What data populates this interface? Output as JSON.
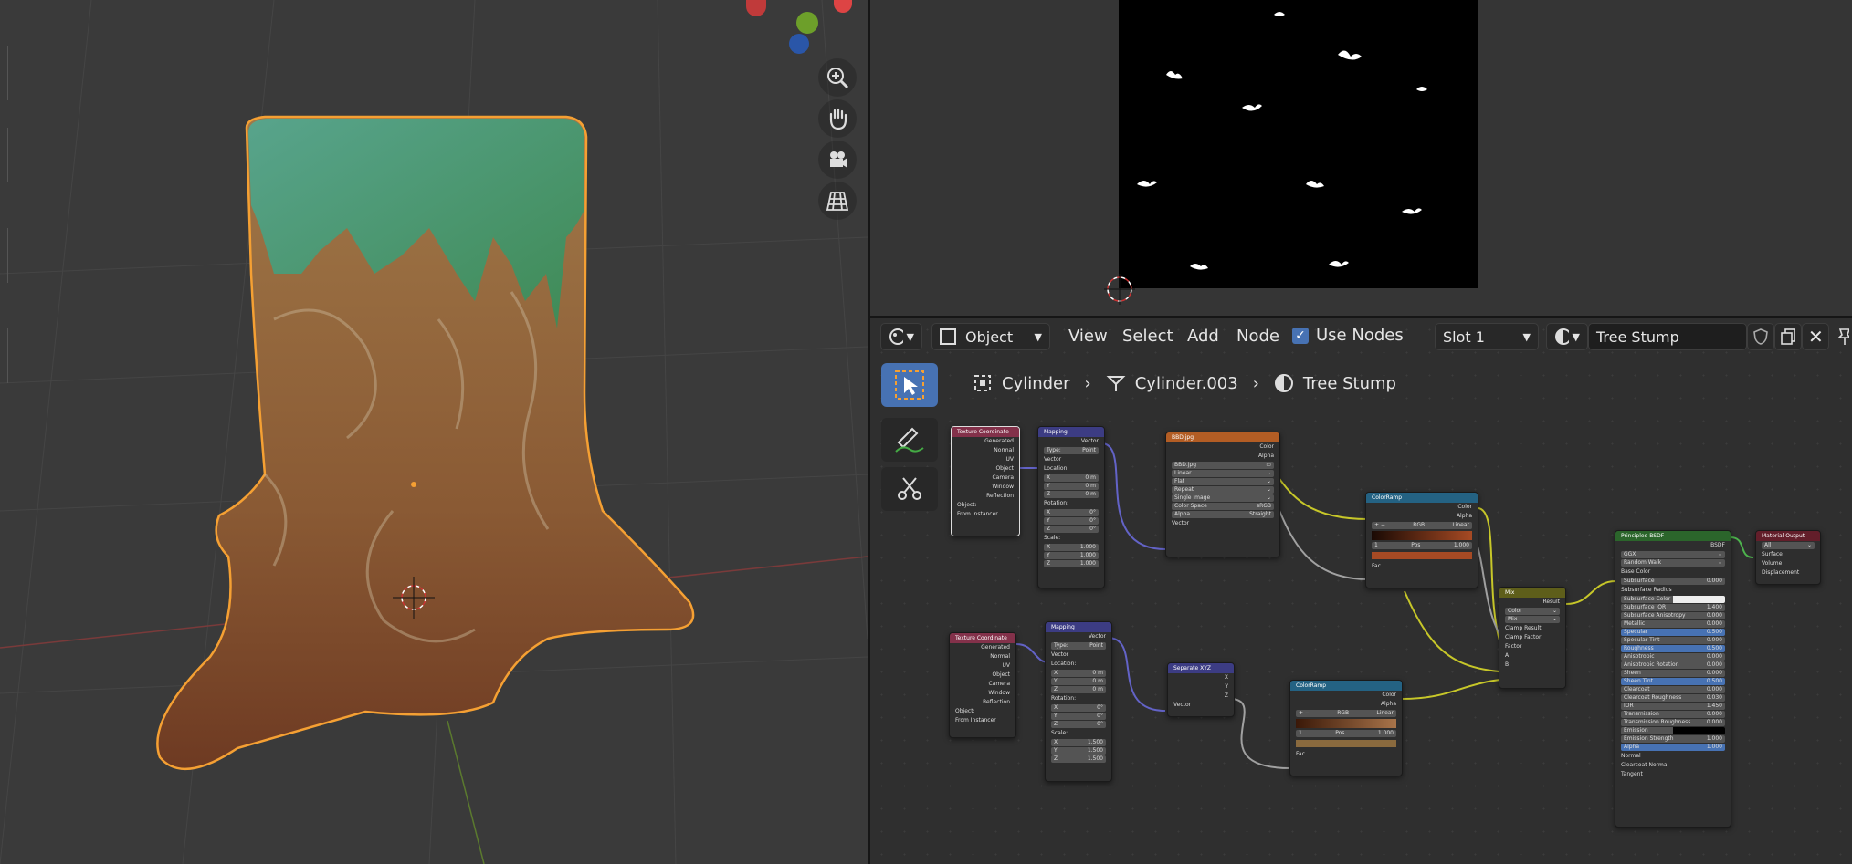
{
  "node_editor": {
    "header": {
      "editor_type_icon": "node-editor-icon",
      "mode_label": "Object",
      "menu_view": "View",
      "menu_select": "Select",
      "menu_add": "Add",
      "menu_node": "Node",
      "use_nodes_label": "Use Nodes",
      "slot_label": "Slot 1",
      "material_name": "Tree Stump"
    },
    "breadcrumb": {
      "object": "Cylinder",
      "mesh": "Cylinder.003",
      "material": "Tree Stump"
    },
    "nodes": {
      "texcoord1": {
        "title": "Texture Coordinate",
        "outputs": [
          "Generated",
          "Normal",
          "UV",
          "Object",
          "Camera",
          "Window",
          "Reflection"
        ],
        "object_label": "Object:",
        "from_instancer": "From Instancer"
      },
      "mapping1": {
        "title": "Mapping",
        "out": "Vector",
        "type_label": "Type:",
        "type_value": "Point",
        "in_vector": "Vector",
        "location": "Location:",
        "rotation": "Rotation:",
        "scale": "Scale:",
        "loc": [
          "0 m",
          "0 m",
          "0 m"
        ],
        "rot": [
          "0°",
          "0°",
          "0°"
        ],
        "scl": [
          "1.000",
          "1.000",
          "1.000"
        ]
      },
      "image": {
        "title": "BBD.jpg",
        "out_color": "Color",
        "out_alpha": "Alpha",
        "file": "BBD.jpg",
        "interp": "Linear",
        "proj": "Flat",
        "ext": "Repeat",
        "source": "Single Image",
        "cs_label": "Color Space",
        "cs_value": "sRGB",
        "alpha_label": "Alpha",
        "alpha_value": "Straight",
        "in_vector": "Vector"
      },
      "ramp1": {
        "title": "ColorRamp",
        "out_color": "Color",
        "out_alpha": "Alpha",
        "mode": "RGB",
        "interp": "Linear",
        "index": "1",
        "pos_label": "Pos",
        "pos_value": "1.000",
        "in_fac": "Fac"
      },
      "mix": {
        "title": "Mix",
        "out_result": "Result",
        "type": "Color",
        "blend": "Mix",
        "clamp_result": "Clamp Result",
        "clamp_factor": "Clamp Factor",
        "in_factor": "Factor",
        "in_a": "A",
        "in_b": "B"
      },
      "texcoord2": {
        "title": "Texture Coordinate",
        "outputs": [
          "Generated",
          "Normal",
          "UV",
          "Object",
          "Camera",
          "Window",
          "Reflection"
        ],
        "object_label": "Object:",
        "from_instancer": "From Instancer"
      },
      "mapping2": {
        "title": "Mapping",
        "out": "Vector",
        "type_label": "Type:",
        "type_value": "Point",
        "in_vector": "Vector",
        "location": "Location:",
        "rotation": "Rotation:",
        "scale": "Scale:",
        "loc": [
          "0 m",
          "0 m",
          "0 m"
        ],
        "rot": [
          "0°",
          "0°",
          "0°"
        ],
        "scl": [
          "1.500",
          "1.500",
          "1.500"
        ]
      },
      "separate": {
        "title": "Separate XYZ",
        "outs": [
          "X",
          "Y",
          "Z"
        ],
        "in_vector": "Vector"
      },
      "ramp2": {
        "title": "ColorRamp",
        "out_color": "Color",
        "out_alpha": "Alpha",
        "mode": "RGB",
        "interp": "Linear",
        "index": "1",
        "pos_label": "Pos",
        "pos_value": "1.000",
        "in_fac": "Fac"
      },
      "bsdf": {
        "title": "Principled BSDF",
        "out": "BSDF",
        "dist": "GGX",
        "sss": "Random Walk",
        "params": [
          [
            "Base Color",
            ""
          ],
          [
            "Subsurface",
            "0.000"
          ],
          [
            "Subsurface Radius",
            ""
          ],
          [
            "Subsurface Color",
            ""
          ],
          [
            "Subsurface IOR",
            "1.400"
          ],
          [
            "Subsurface Anisotropy",
            "0.000"
          ],
          [
            "Metallic",
            "0.000"
          ],
          [
            "Specular",
            "0.500"
          ],
          [
            "Specular Tint",
            "0.000"
          ],
          [
            "Roughness",
            "0.500"
          ],
          [
            "Anisotropic",
            "0.000"
          ],
          [
            "Anisotropic Rotation",
            "0.000"
          ],
          [
            "Sheen",
            "0.000"
          ],
          [
            "Sheen Tint",
            "0.500"
          ],
          [
            "Clearcoat",
            "0.000"
          ],
          [
            "Clearcoat Roughness",
            "0.030"
          ],
          [
            "IOR",
            "1.450"
          ],
          [
            "Transmission",
            "0.000"
          ],
          [
            "Transmission Roughness",
            "0.000"
          ],
          [
            "Emission",
            ""
          ],
          [
            "Emission Strength",
            "1.000"
          ],
          [
            "Alpha",
            "1.000"
          ],
          [
            "Normal",
            ""
          ],
          [
            "Clearcoat Normal",
            ""
          ],
          [
            "Tangent",
            ""
          ]
        ]
      },
      "output": {
        "title": "Material Output",
        "target": "All",
        "ins": [
          "Surface",
          "Volume",
          "Displacement"
        ]
      }
    }
  },
  "colors": {
    "accent": "#4772b3",
    "object_outline": "#f5a033",
    "vector_node": "#3c3c83",
    "input_node": "#83314a",
    "texture_node": "#b35d24",
    "converter_node": "#246283",
    "shader_node": "#2b652b",
    "output_node": "#631e2a"
  }
}
